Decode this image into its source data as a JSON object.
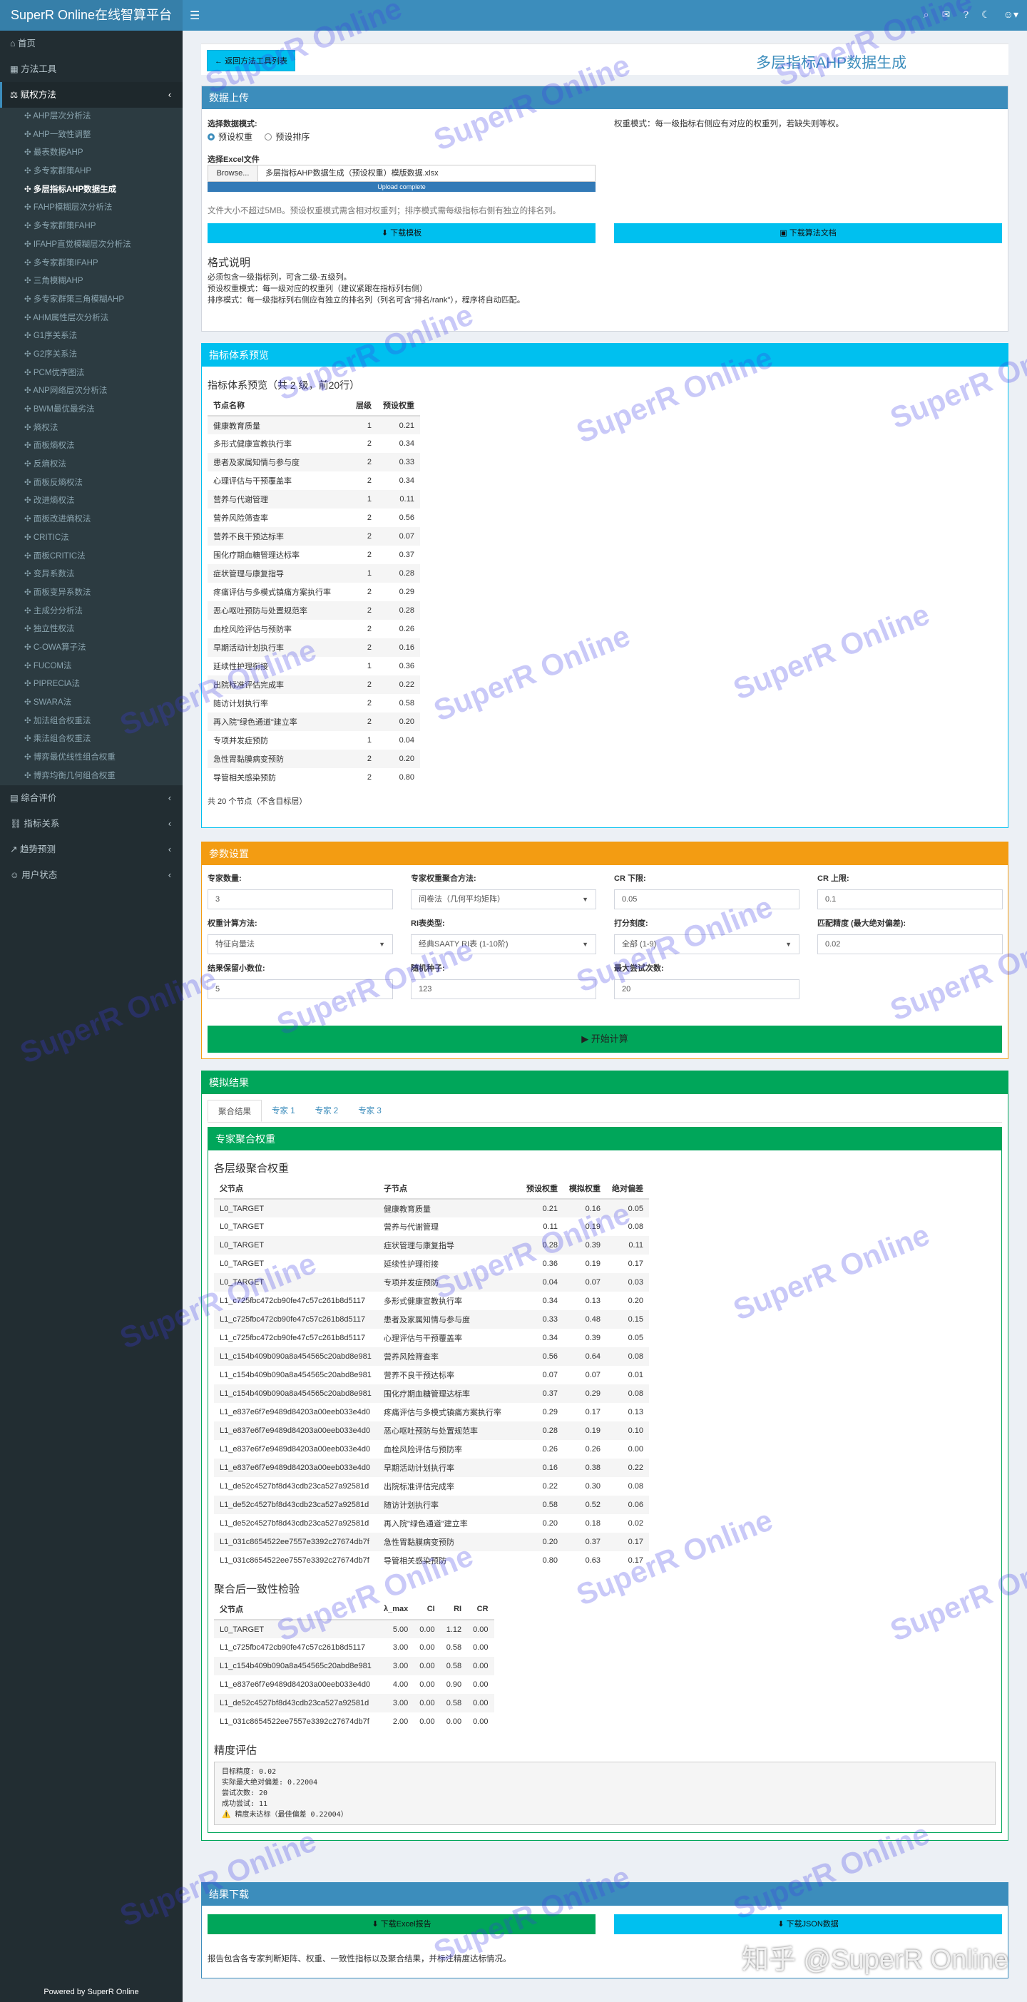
{
  "app": {
    "brand": "SuperR Online在线智算平台",
    "footer": "Powered by SuperR Online"
  },
  "sidebar": {
    "top": [
      {
        "label": "首页",
        "icon": "home-icon"
      },
      {
        "label": "方法工具",
        "icon": "grid-icon"
      },
      {
        "label": "赋权方法",
        "icon": "balance-icon"
      }
    ],
    "subitems": [
      "AHP层次分析法",
      "AHP一致性调整",
      "最表数据AHP",
      "多专家群策AHP",
      "多层指标AHP数据生成",
      "FAHP模糊层次分析法",
      "多专家群策FAHP",
      "IFAHP直觉模糊层次分析法",
      "多专家群策IFAHP",
      "三角模糊AHP",
      "多专家群策三角模糊AHP",
      "AHM属性层次分析法",
      "G1序关系法",
      "G2序关系法",
      "PCM优序图法",
      "ANP网络层次分析法",
      "BWM最优最劣法",
      "熵权法",
      "面板熵权法",
      "反熵权法",
      "面板反熵权法",
      "改进熵权法",
      "面板改进熵权法",
      "CRITIC法",
      "面板CRITIC法",
      "变异系数法",
      "面板变异系数法",
      "主成分分析法",
      "独立性权法",
      "C-OWA算子法",
      "FUCOM法",
      "PIPRECIA法",
      "SWARA法",
      "加法组合权重法",
      "乘法组合权重法",
      "博弈最优线性组合权重",
      "博弈均衡几何组合权重"
    ],
    "active": "多层指标AHP数据生成",
    "bottom": [
      {
        "label": "综合评价",
        "icon": "chart-icon"
      },
      {
        "label": "指标关系",
        "icon": "link-icon"
      },
      {
        "label": "趋势预测",
        "icon": "line-icon"
      },
      {
        "label": "用户状态",
        "icon": "user-icon"
      }
    ]
  },
  "header": {
    "back": "返回方法工具列表",
    "title": "多层指标AHP数据生成"
  },
  "upload": {
    "title": "数据上传",
    "mode_label": "选择数据模式:",
    "opt1": "预设权重",
    "opt2": "预设排序",
    "file_label": "选择Excel文件",
    "browse": "Browse...",
    "file": "多层指标AHP数据生成（预设权重）模版数据.xlsx",
    "progress": "Upload complete",
    "note": "文件大小不超过5MB。预设权重模式需含相对权重列；排序模式需每级指标右侧有独立的排名列。",
    "mode_hint": "权重模式：每一级指标右侧应有对应的权重列，若缺失则等权。",
    "btn_tpl": "下载模板",
    "btn_doc": "下载算法文档",
    "fmt_title": "格式说明",
    "fmt1": "必须包含一级指标列，可含二级-五级列。",
    "fmt2": "预设权重模式：每一级对应的权重列（建议紧跟在指标列右侧）",
    "fmt3": "排序模式：每一级指标列右侧应有独立的排名列（列名可含\"排名/rank\"），程序将自动匹配。"
  },
  "preview": {
    "title": "指标体系预览",
    "subtitle": "指标体系预览（共 2 级，前20行）",
    "cols": [
      "节点名称",
      "层级",
      "预设权重"
    ],
    "rows": [
      [
        "健康教育质量",
        "1",
        "0.21"
      ],
      [
        "多形式健康宣教执行率",
        "2",
        "0.34"
      ],
      [
        "患者及家属知情与参与度",
        "2",
        "0.33"
      ],
      [
        "心理评估与干预覆盖率",
        "2",
        "0.34"
      ],
      [
        "营养与代谢管理",
        "1",
        "0.11"
      ],
      [
        "营养风险筛查率",
        "2",
        "0.56"
      ],
      [
        "营养不良干预达标率",
        "2",
        "0.07"
      ],
      [
        "围化疗期血糖管理达标率",
        "2",
        "0.37"
      ],
      [
        "症状管理与康复指导",
        "1",
        "0.28"
      ],
      [
        "疼痛评估与多模式镇痛方案执行率",
        "2",
        "0.29"
      ],
      [
        "恶心呕吐预防与处置规范率",
        "2",
        "0.28"
      ],
      [
        "血栓风险评估与预防率",
        "2",
        "0.26"
      ],
      [
        "早期活动计划执行率",
        "2",
        "0.16"
      ],
      [
        "延续性护理衔接",
        "1",
        "0.36"
      ],
      [
        "出院标准评估完成率",
        "2",
        "0.22"
      ],
      [
        "随访计划执行率",
        "2",
        "0.58"
      ],
      [
        "再入院\"绿色通道\"建立率",
        "2",
        "0.20"
      ],
      [
        "专项并发症预防",
        "1",
        "0.04"
      ],
      [
        "急性胃黏膜病变预防",
        "2",
        "0.20"
      ],
      [
        "导管相关感染预防",
        "2",
        "0.80"
      ]
    ],
    "footer": "共 20 个节点（不含目标层）"
  },
  "params": {
    "title": "参数设置",
    "fields": [
      {
        "label": "专家数量:",
        "value": "3"
      },
      {
        "label": "专家权重聚合方法:",
        "value": "间卷法（几何平均矩阵）",
        "select": true
      },
      {
        "label": "CR 下限:",
        "value": "0.05"
      },
      {
        "label": "CR 上限:",
        "value": "0.1"
      },
      {
        "label": "权重计算方法:",
        "value": "特征向量法",
        "select": true
      },
      {
        "label": "RI表类型:",
        "value": "经典SAATY RI表 (1-10阶)",
        "select": true
      },
      {
        "label": "打分刻度:",
        "value": "全部 (1-9)",
        "select": true
      },
      {
        "label": "匹配精度 (最大绝对偏差):",
        "value": "0.02"
      },
      {
        "label": "结果保留小数位:",
        "value": "5"
      },
      {
        "label": "随机种子:",
        "value": "123"
      },
      {
        "label": "最大尝试次数:",
        "value": "20"
      }
    ],
    "run": "开始计算"
  },
  "results": {
    "title": "模拟结果",
    "tabs": [
      "聚合结果",
      "专家 1",
      "专家 2",
      "专家 3"
    ],
    "inner_title": "专家聚合权重",
    "agg_title": "各层级聚合权重",
    "agg_cols": [
      "父节点",
      "子节点",
      "预设权重",
      "模拟权重",
      "绝对偏差"
    ],
    "agg_rows": [
      [
        "L0_TARGET",
        "健康教育质量",
        "0.21",
        "0.16",
        "0.05"
      ],
      [
        "L0_TARGET",
        "营养与代谢管理",
        "0.11",
        "0.19",
        "0.08"
      ],
      [
        "L0_TARGET",
        "症状管理与康复指导",
        "0.28",
        "0.39",
        "0.11"
      ],
      [
        "L0_TARGET",
        "延续性护理衔接",
        "0.36",
        "0.19",
        "0.17"
      ],
      [
        "L0_TARGET",
        "专项并发症预防",
        "0.04",
        "0.07",
        "0.03"
      ],
      [
        "L1_c725fbc472cb90fe47c57c261b8d5117",
        "多形式健康宣教执行率",
        "0.34",
        "0.13",
        "0.20"
      ],
      [
        "L1_c725fbc472cb90fe47c57c261b8d5117",
        "患者及家属知情与参与度",
        "0.33",
        "0.48",
        "0.15"
      ],
      [
        "L1_c725fbc472cb90fe47c57c261b8d5117",
        "心理评估与干预覆盖率",
        "0.34",
        "0.39",
        "0.05"
      ],
      [
        "L1_c154b409b090a8a454565c20abd8e981",
        "营养风险筛查率",
        "0.56",
        "0.64",
        "0.08"
      ],
      [
        "L1_c154b409b090a8a454565c20abd8e981",
        "营养不良干预达标率",
        "0.07",
        "0.07",
        "0.01"
      ],
      [
        "L1_c154b409b090a8a454565c20abd8e981",
        "围化疗期血糖管理达标率",
        "0.37",
        "0.29",
        "0.08"
      ],
      [
        "L1_e837e6f7e9489d84203a00eeb033e4d0",
        "疼痛评估与多模式镇痛方案执行率",
        "0.29",
        "0.17",
        "0.13"
      ],
      [
        "L1_e837e6f7e9489d84203a00eeb033e4d0",
        "恶心呕吐预防与处置规范率",
        "0.28",
        "0.19",
        "0.10"
      ],
      [
        "L1_e837e6f7e9489d84203a00eeb033e4d0",
        "血栓风险评估与预防率",
        "0.26",
        "0.26",
        "0.00"
      ],
      [
        "L1_e837e6f7e9489d84203a00eeb033e4d0",
        "早期活动计划执行率",
        "0.16",
        "0.38",
        "0.22"
      ],
      [
        "L1_de52c4527bf8d43cdb23ca527a92581d",
        "出院标准评估完成率",
        "0.22",
        "0.30",
        "0.08"
      ],
      [
        "L1_de52c4527bf8d43cdb23ca527a92581d",
        "随访计划执行率",
        "0.58",
        "0.52",
        "0.06"
      ],
      [
        "L1_de52c4527bf8d43cdb23ca527a92581d",
        "再入院\"绿色通道\"建立率",
        "0.20",
        "0.18",
        "0.02"
      ],
      [
        "L1_031c8654522ee7557e3392c27674db7f",
        "急性胃黏膜病变预防",
        "0.20",
        "0.37",
        "0.17"
      ],
      [
        "L1_031c8654522ee7557e3392c27674db7f",
        "导管相关感染预防",
        "0.80",
        "0.63",
        "0.17"
      ]
    ],
    "cons_title": "聚合后一致性检验",
    "cons_cols": [
      "父节点",
      "λ_max",
      "CI",
      "RI",
      "CR"
    ],
    "cons_rows": [
      [
        "L0_TARGET",
        "5.00",
        "0.00",
        "1.12",
        "0.00"
      ],
      [
        "L1_c725fbc472cb90fe47c57c261b8d5117",
        "3.00",
        "0.00",
        "0.58",
        "0.00"
      ],
      [
        "L1_c154b409b090a8a454565c20abd8e981",
        "3.00",
        "0.00",
        "0.58",
        "0.00"
      ],
      [
        "L1_e837e6f7e9489d84203a00eeb033e4d0",
        "4.00",
        "0.00",
        "0.90",
        "0.00"
      ],
      [
        "L1_de52c4527bf8d43cdb23ca527a92581d",
        "3.00",
        "0.00",
        "0.58",
        "0.00"
      ],
      [
        "L1_031c8654522ee7557e3392c27674db7f",
        "2.00",
        "0.00",
        "0.00",
        "0.00"
      ]
    ],
    "prec_title": "精度评估",
    "prec": [
      "目标精度: 0.02",
      "实际最大绝对偏差: 0.22004",
      "尝试次数: 20",
      "成功尝试: 11",
      "⚠️ 精度未达标（最佳偏差 0.22004）"
    ]
  },
  "download": {
    "title": "结果下载",
    "btn1": "下载Excel报告",
    "btn2": "下载JSON数据",
    "note": "报告包含各专家判断矩阵、权重、一致性指标以及聚合结果，并标注精度达标情况。"
  },
  "watermark": {
    "text": "SuperR Online",
    "zh": "知乎 @SuperR Online"
  },
  "colors": {
    "primary": "#3c8dbc",
    "info": "#00c0ef",
    "success": "#00a65a",
    "warning": "#f39c12"
  }
}
